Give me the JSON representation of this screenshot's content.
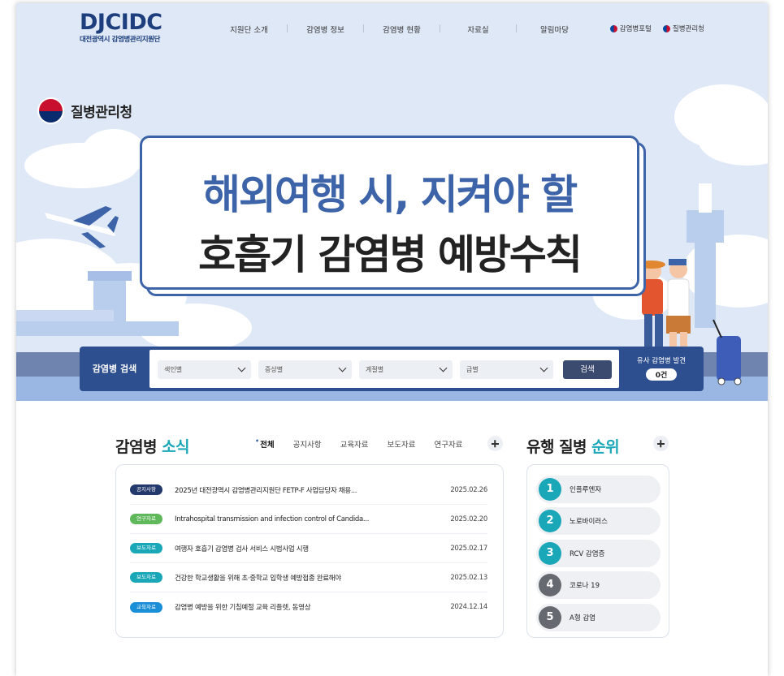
{
  "header": {
    "logo": "DJCIDC",
    "logo_sub": "대전광역시 감염병관리지원단",
    "nav": [
      "지원단 소개",
      "감염병 정보",
      "감염병 현황",
      "자료실",
      "알림마당"
    ],
    "util_links": [
      "감염병포털",
      "질병관리청"
    ]
  },
  "hero": {
    "agency": "질병관리청",
    "line1": "해외여행 시, 지켜야 할",
    "line2": "호흡기 감염병 예방수칙"
  },
  "search": {
    "label": "감염병 검색",
    "selects": [
      "색인별",
      "증상별",
      "계절별",
      "급별"
    ],
    "button": "검색",
    "similar_label": "유사 감염병 발견",
    "similar_count": "0건"
  },
  "news": {
    "title_prefix": "감염병 ",
    "title_accent": "소식",
    "tabs": [
      "전체",
      "공지사항",
      "교육자료",
      "보도자료",
      "연구자료"
    ],
    "items": [
      {
        "badge": "공지사항",
        "badge_color": "#23386b",
        "text": "2025년 대전광역시 감염병관리지원단 FETP-F 사업담당자 채용...",
        "date": "2025.02.26"
      },
      {
        "badge": "연구자료",
        "badge_color": "#5fb85a",
        "text": "Intrahospital transmission and infection control of Candida...",
        "date": "2025.02.20"
      },
      {
        "badge": "보도자료",
        "badge_color": "#1aa7b8",
        "text": "여행자 호흡기 감염병 검사 서비스 시범사업 시행",
        "date": "2025.02.17"
      },
      {
        "badge": "보도자료",
        "badge_color": "#1aa7b8",
        "text": "건강한 학교생활을 위해 초·중학교 입학생 예방접종 완료해야",
        "date": "2025.02.13"
      },
      {
        "badge": "교육자료",
        "badge_color": "#1a8fd8",
        "text": "감염병 예방을 위한 기침예절 교육 리플렛, 동영상",
        "date": "2024.12.14"
      }
    ]
  },
  "ranking": {
    "title_prefix": "유행 질병 ",
    "title_accent": "순위",
    "items": [
      {
        "num": "1",
        "name": "인플루엔자",
        "color": "#1aa7b8"
      },
      {
        "num": "2",
        "name": "노로바이러스",
        "color": "#1aa7b8"
      },
      {
        "num": "3",
        "name": "RCV 감염증",
        "color": "#1aa7b8"
      },
      {
        "num": "4",
        "name": "코로나 19",
        "color": "#666a70"
      },
      {
        "num": "5",
        "name": "A형 감염",
        "color": "#666a70"
      }
    ]
  }
}
